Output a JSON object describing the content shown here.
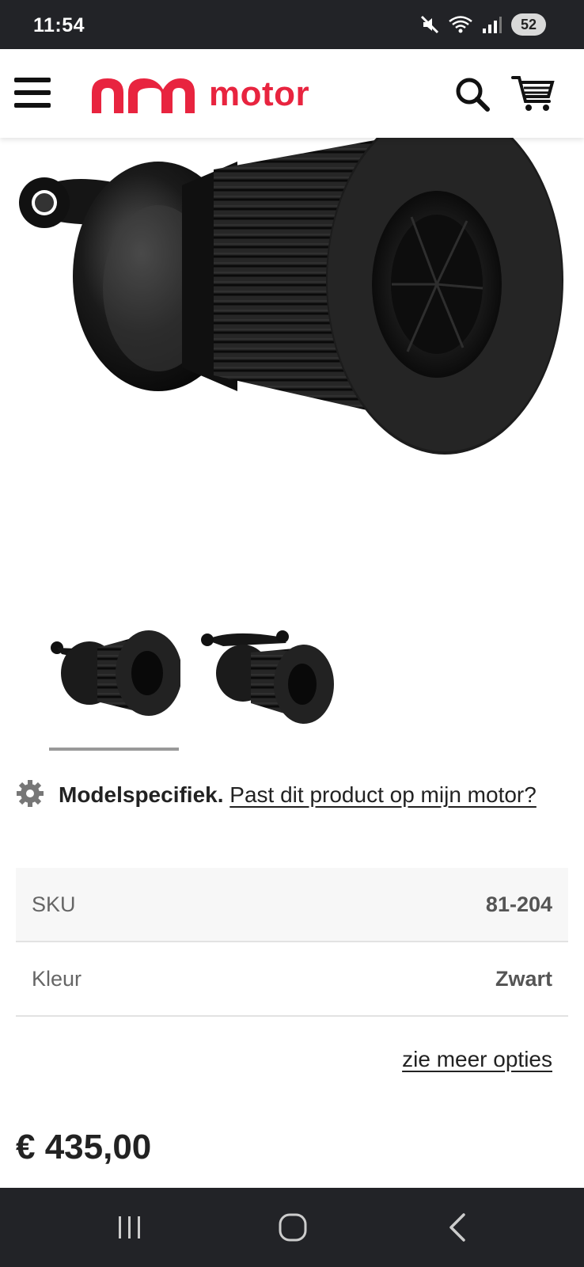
{
  "status_bar": {
    "time": "11:54",
    "battery": "52",
    "icons": [
      "mute-icon",
      "wifi-icon",
      "signal-icon"
    ]
  },
  "header": {
    "logo_text": "motor",
    "brand_color": "#e8243f",
    "icons": [
      "menu-icon",
      "search-icon",
      "cart-icon"
    ]
  },
  "product": {
    "image_alt": "air-filter-product-image",
    "thumbnails": [
      "thumbnail-1",
      "thumbnail-2"
    ],
    "active_thumbnail": 0
  },
  "model_specific": {
    "label": "Modelspecifiek.",
    "link_text": "Past dit product op mijn motor?"
  },
  "specs": [
    {
      "label": "SKU",
      "value": "81-204"
    },
    {
      "label": "Kleur",
      "value": "Zwart"
    }
  ],
  "more_options_label": "zie meer opties",
  "price": "€ 435,00",
  "nav_bar": {
    "buttons": [
      "recent-apps-icon",
      "home-icon",
      "back-icon"
    ]
  }
}
